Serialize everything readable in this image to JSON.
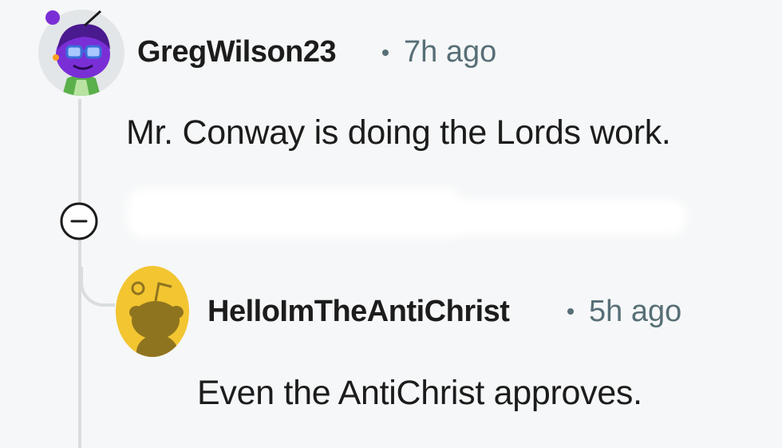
{
  "comments": [
    {
      "username": "GregWilson23",
      "time": "7h ago",
      "body": "Mr. Conway is doing the Lords work.",
      "avatar_icon": "snoo-avatar-purple"
    },
    {
      "username": "HelloImTheAntiChrist",
      "time": "5h ago",
      "body": "Even the AntiChrist approves.",
      "avatar_icon": "snoo-avatar-yellow"
    }
  ],
  "colors": {
    "background": "#f6f7f8",
    "text": "#1c1c1c",
    "meta": "#576f76",
    "thread_line": "#d9dde0",
    "avatar_purple": "#7a2fd6",
    "avatar_yellow": "#f2c531"
  },
  "collapse_icon": "minus-circle-icon"
}
